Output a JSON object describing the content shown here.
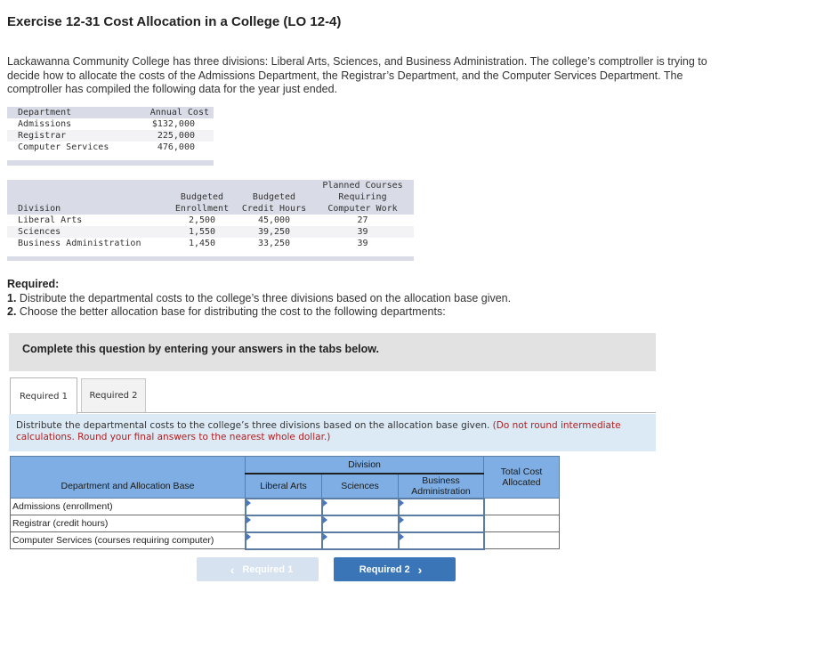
{
  "title": "Exercise 12-31 Cost Allocation in a College (LO 12-4)",
  "intro": "Lackawanna Community College has three divisions: Liberal Arts, Sciences, and Business Administration. The college’s comptroller is trying to decide how to allocate the costs of the Admissions Department, the Registrar’s Department, and the Computer Services Department. The comptroller has compiled the following data for the year just ended.",
  "dept_table": {
    "headers": [
      "Department",
      "Annual Cost"
    ],
    "rows": [
      {
        "department": "Admissions",
        "cost": "$132,000"
      },
      {
        "department": "Registrar",
        "cost": "225,000"
      },
      {
        "department": "Computer Services",
        "cost": "476,000"
      }
    ]
  },
  "division_table": {
    "headers": {
      "division": "Division",
      "enrollment_1": "Budgeted",
      "enrollment_2": "Enrollment",
      "credit_1": "Budgeted",
      "credit_2": "Credit Hours",
      "courses_1": "Planned Courses",
      "courses_2": "Requiring",
      "courses_3": "Computer Work"
    },
    "rows": [
      {
        "division": "Liberal Arts",
        "enrollment": "2,500",
        "credit_hours": "45,000",
        "courses": "27"
      },
      {
        "division": "Sciences",
        "enrollment": "1,550",
        "credit_hours": "39,250",
        "courses": "39"
      },
      {
        "division": "Business Administration",
        "enrollment": "1,450",
        "credit_hours": "33,250",
        "courses": "39"
      }
    ]
  },
  "required": {
    "heading": "Required:",
    "item1_num": "1.",
    "item1_text": " Distribute the departmental costs to the college’s three divisions based on the allocation base given.",
    "item2_num": "2.",
    "item2_text": " Choose the better allocation base for distributing the cost to the following departments:"
  },
  "banner": "Complete this question by entering your answers in the tabs below.",
  "tabs": [
    {
      "label": "Required 1",
      "active": true
    },
    {
      "label": "Required 2",
      "active": false
    }
  ],
  "instruction": {
    "text": "Distribute the departmental costs to the college’s three divisions based on the allocation base given. ",
    "note": "(Do not round intermediate calculations. Round your final answers to the nearest whole dollar.)"
  },
  "answer_table": {
    "group_header": "Division",
    "col_base": "Department and Allocation Base",
    "col_liberal": "Liberal Arts",
    "col_sciences": "Sciences",
    "col_business_1": "Business",
    "col_business_2": "Administration",
    "col_total_1": "Total Cost",
    "col_total_2": "Allocated",
    "rows": [
      {
        "label": "Admissions (enrollment)",
        "liberal": "",
        "sciences": "",
        "business": "",
        "total": ""
      },
      {
        "label": "Registrar (credit hours)",
        "liberal": "",
        "sciences": "",
        "business": "",
        "total": ""
      },
      {
        "label": "Computer Services (courses requiring computer)",
        "liberal": "",
        "sciences": "",
        "business": "",
        "total": ""
      }
    ]
  },
  "nav": {
    "prev_label": "Required 1",
    "next_label": "Required 2",
    "prev_icon": "chevron-left-icon",
    "next_icon": "chevron-right-icon"
  },
  "colors": {
    "header_blue": "#7eaee3",
    "next_button": "#3a75b8",
    "prev_button_disabled": "#d6e2f0",
    "instruction_bg": "#dceaf6",
    "note_red": "#b02020"
  }
}
